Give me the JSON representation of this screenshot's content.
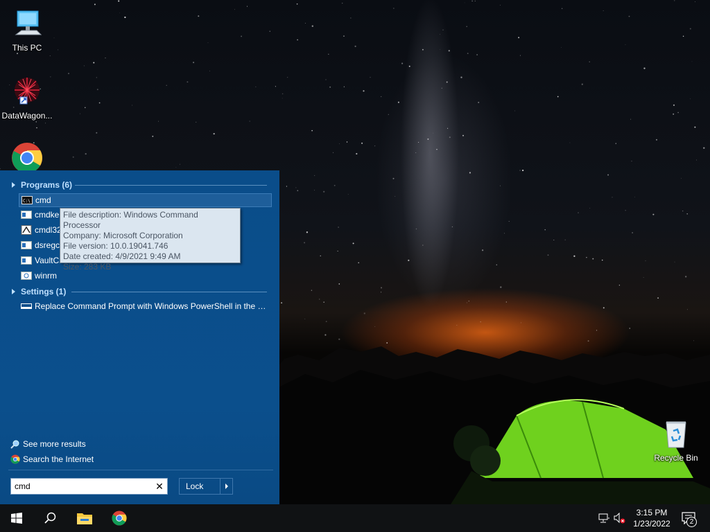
{
  "desktop": {
    "icons": [
      {
        "label": "This PC",
        "icon": "this-pc-icon"
      },
      {
        "label": "DataWagon...",
        "icon": "datawagon-icon"
      },
      {
        "label": "",
        "icon": "chrome-icon"
      },
      {
        "label": "Recycle Bin",
        "icon": "recycle-bin-icon"
      }
    ]
  },
  "search_panel": {
    "programs_header": "Programs (6)",
    "programs": [
      {
        "label": "cmd",
        "icon": "cmd-icon",
        "selected": true
      },
      {
        "label": "cmdke",
        "icon": "app-window-icon"
      },
      {
        "label": "cmdl32",
        "icon": "cmdl32-icon"
      },
      {
        "label": "dsregc",
        "icon": "app-window-icon"
      },
      {
        "label": "VaultCmd",
        "icon": "app-window-icon"
      },
      {
        "label": "winrm",
        "icon": "winrm-icon"
      }
    ],
    "settings_header": "Settings (1)",
    "settings": [
      {
        "label": "Replace Command Prompt with Windows PowerShell in the W...",
        "icon": "taskbar-setting-icon"
      }
    ],
    "tooltip": {
      "line1": "File description: Windows Command Processor",
      "line2": "Company: Microsoft Corporation",
      "line3": "File version: 10.0.19041.746",
      "line4": "Date created: 4/9/2021 9:49 AM",
      "line5": "Size: 283 KB"
    },
    "see_more_results": "See more results",
    "search_internet": "Search the Internet",
    "search_value": "cmd",
    "lock_label": "Lock"
  },
  "taskbar": {
    "time": "3:15 PM",
    "date": "1/23/2022",
    "notification_count": "2"
  },
  "colors": {
    "panel_bg": "#0b4f8c",
    "header_text": "#bfe0ff",
    "taskbar_bg": "#101214",
    "tooltip_bg": "#dbe6f0"
  }
}
